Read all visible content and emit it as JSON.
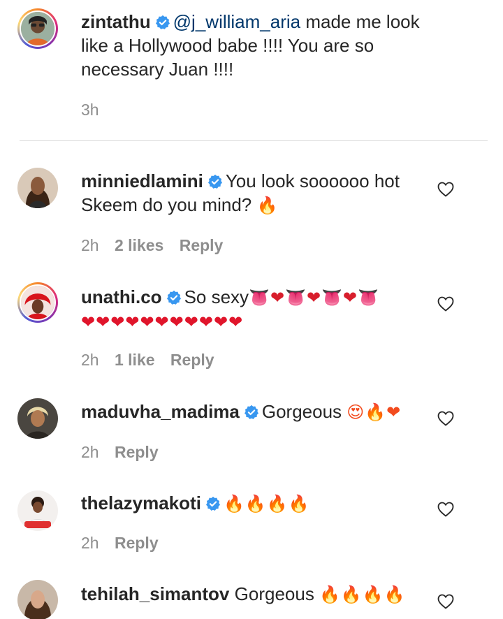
{
  "colors": {
    "text": "#262626",
    "muted": "#8e8e8e",
    "mention": "#00376b",
    "verified": "#3897f0",
    "divider": "#dbdbdb"
  },
  "caption": {
    "username": "zintathu",
    "mention": "@j_william_aria",
    "text_line1": " made me look",
    "text_line2": "like a Hollywood babe !!!! You are so",
    "text_line3": "necessary Juan !!!!",
    "time": "3h"
  },
  "comments": [
    {
      "username": "minniedlamini",
      "text_line1": "You look soooooo hot",
      "text_line2": "Skeem do you mind? ",
      "emoji_line2": "🔥",
      "time": "2h",
      "likes": "2 likes",
      "reply": "Reply"
    },
    {
      "username": "unathi.co",
      "text_line1": "So sexy",
      "emoji_line1": "👅❤👅❤👅❤👅",
      "emoji_line2": "❤❤❤❤❤❤❤❤❤❤❤",
      "time": "2h",
      "likes": "1 like",
      "reply": "Reply"
    },
    {
      "username": "maduvha_madima",
      "text_line1": "Gorgeous ",
      "emoji_line1": "😍🔥❤",
      "time": "2h",
      "reply": "Reply"
    },
    {
      "username": "thelazymakoti",
      "text_line1": "",
      "emoji_line1": "🔥🔥🔥🔥",
      "time": "2h",
      "reply": "Reply"
    },
    {
      "username": "tehilah_simantov",
      "text_line1": "Gorgeous ",
      "emoji_line1": "🔥🔥🔥🔥"
    }
  ],
  "icons": {
    "verified": "verified-badge-icon",
    "like": "heart-outline-icon"
  }
}
